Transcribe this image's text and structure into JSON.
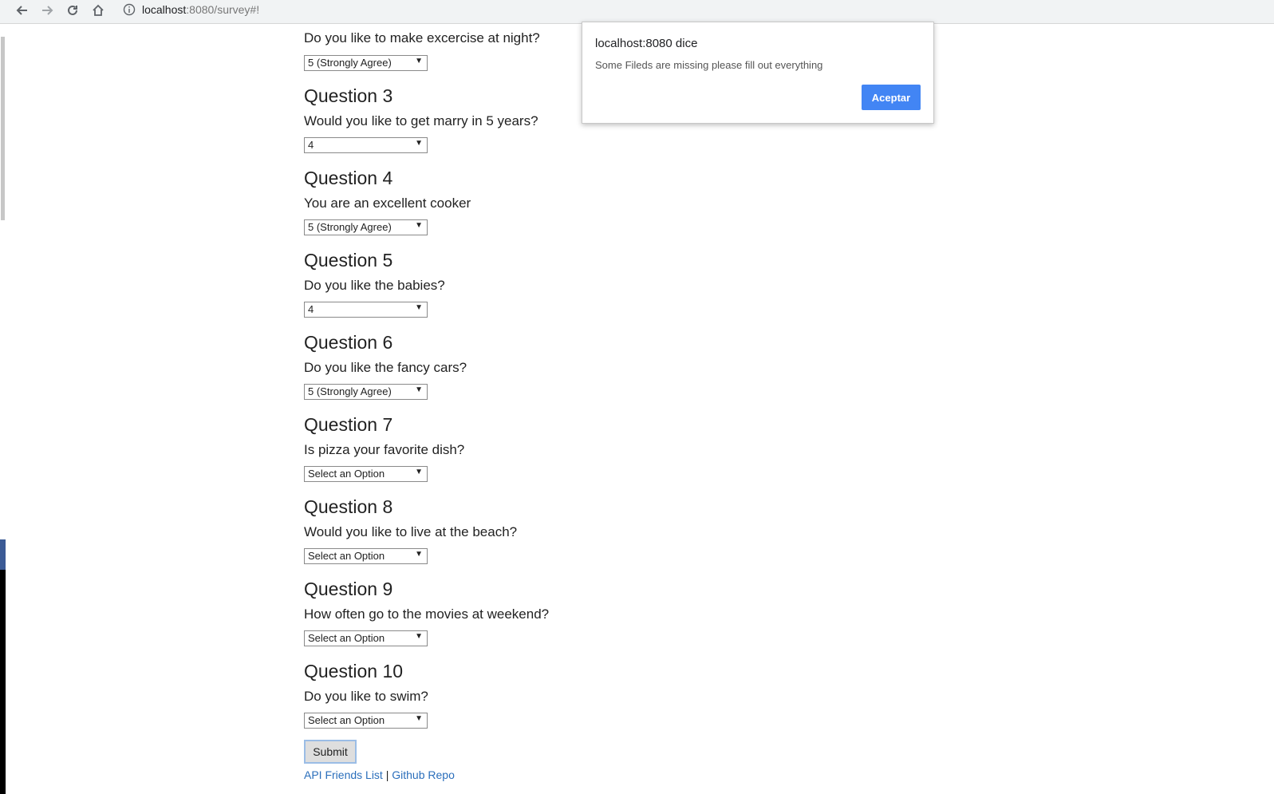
{
  "browser": {
    "url_host": "localhost",
    "url_path": ":8080/survey#!",
    "icons": [
      "back-icon",
      "forward-icon",
      "reload-icon",
      "home-icon",
      "info-icon"
    ]
  },
  "survey": {
    "top_question_text": "Do you like to make excercise at night?",
    "top_select_value": "5 (Strongly Agree)",
    "questions": [
      {
        "title": "Question 3",
        "text": "Would you like to get marry in 5 years?",
        "value": "4"
      },
      {
        "title": "Question 4",
        "text": "You are an excellent cooker",
        "value": "5 (Strongly Agree)"
      },
      {
        "title": "Question 5",
        "text": "Do you like the babies?",
        "value": "4"
      },
      {
        "title": "Question 6",
        "text": "Do you like the fancy cars?",
        "value": "5 (Strongly Agree)"
      },
      {
        "title": "Question 7",
        "text": "Is pizza your favorite dish?",
        "value": "Select an Option"
      },
      {
        "title": "Question 8",
        "text": "Would you like to live at the beach?",
        "value": "Select an Option"
      },
      {
        "title": "Question 9",
        "text": "How often go to the movies at weekend?",
        "value": "Select an Option"
      },
      {
        "title": "Question 10",
        "text": "Do you like to swim?",
        "value": "Select an Option"
      }
    ],
    "submit_label": "Submit",
    "footer": {
      "link1": "API Friends List",
      "separator": "|",
      "link2": "Github Repo"
    }
  },
  "dialog": {
    "title": "localhost:8080 dice",
    "message": "Some Fileds are missing please fill out everything",
    "button_label": "Aceptar",
    "button_color": "#4285f4"
  }
}
